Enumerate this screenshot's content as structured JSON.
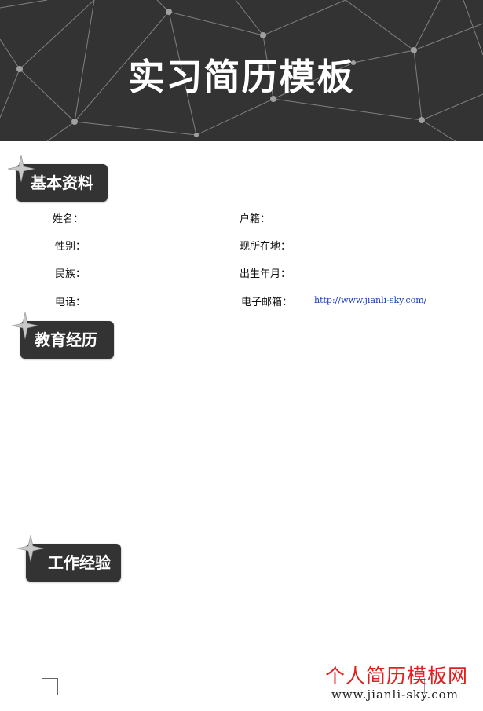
{
  "header": {
    "title": "实习简历模板"
  },
  "sections": {
    "basic": "基本资料",
    "education": "教育经历",
    "work": "工作经验"
  },
  "basic_info": {
    "name_label": "姓名：",
    "hometown_label": "户籍：",
    "gender_label": "性别：",
    "location_label": "现所在地：",
    "ethnicity_label": "民族：",
    "birth_label": "出生年月：",
    "phone_label": "电话：",
    "email_label": "电子邮箱：",
    "email_value": "http://www.jianli-sky.com/"
  },
  "watermark": {
    "brand": "个人简历模板网",
    "url": "www.jianli-sky.com"
  },
  "colors": {
    "dark": "#333333",
    "watermark_red": "#e02020"
  }
}
